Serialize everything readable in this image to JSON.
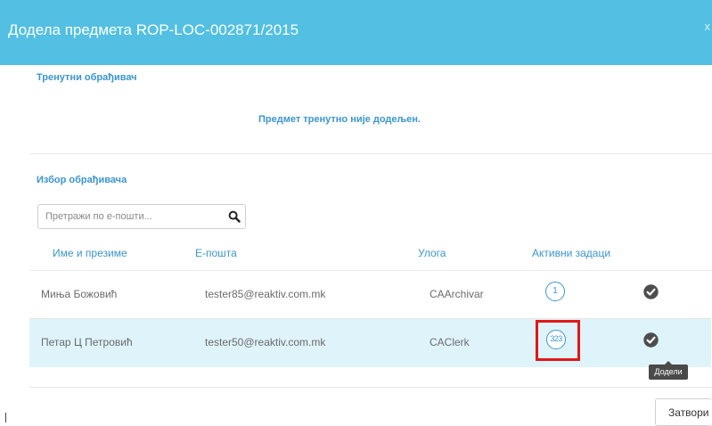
{
  "modal": {
    "title": "Додела предмета ROP-LOC-002871/2015",
    "close_glyph": "x"
  },
  "current_handler": {
    "label": "Тренутни обрађивач",
    "notice": "Предмет тренутно није додељен."
  },
  "selection": {
    "label": "Избор обрађивача",
    "search_placeholder": "Претражи по е-пошти...",
    "search_value": ""
  },
  "table": {
    "headers": {
      "name": "Име и презиме",
      "email": "Е-пошта",
      "role": "Улога",
      "active_tasks": "Активни задаци"
    },
    "rows": [
      {
        "name": "Миња Божовић",
        "email": "tester85@reaktiv.com.mk",
        "role": "CAArchivar",
        "active_tasks": "1"
      },
      {
        "name": "Петар Ц Петровић",
        "email": "tester50@reaktiv.com.mk",
        "role": "CAClerk",
        "active_tasks": "323"
      }
    ]
  },
  "tooltip": {
    "text": "Додели"
  },
  "footer": {
    "close_label": "Затвори"
  },
  "colors": {
    "header_bg": "#52bfe3",
    "accent": "#3b95d1",
    "selected_row_bg": "#dff3fb",
    "highlight_border": "#e01818"
  },
  "icons": {
    "search": "search-icon",
    "assign": "check-circle-icon",
    "close": "close-icon"
  }
}
